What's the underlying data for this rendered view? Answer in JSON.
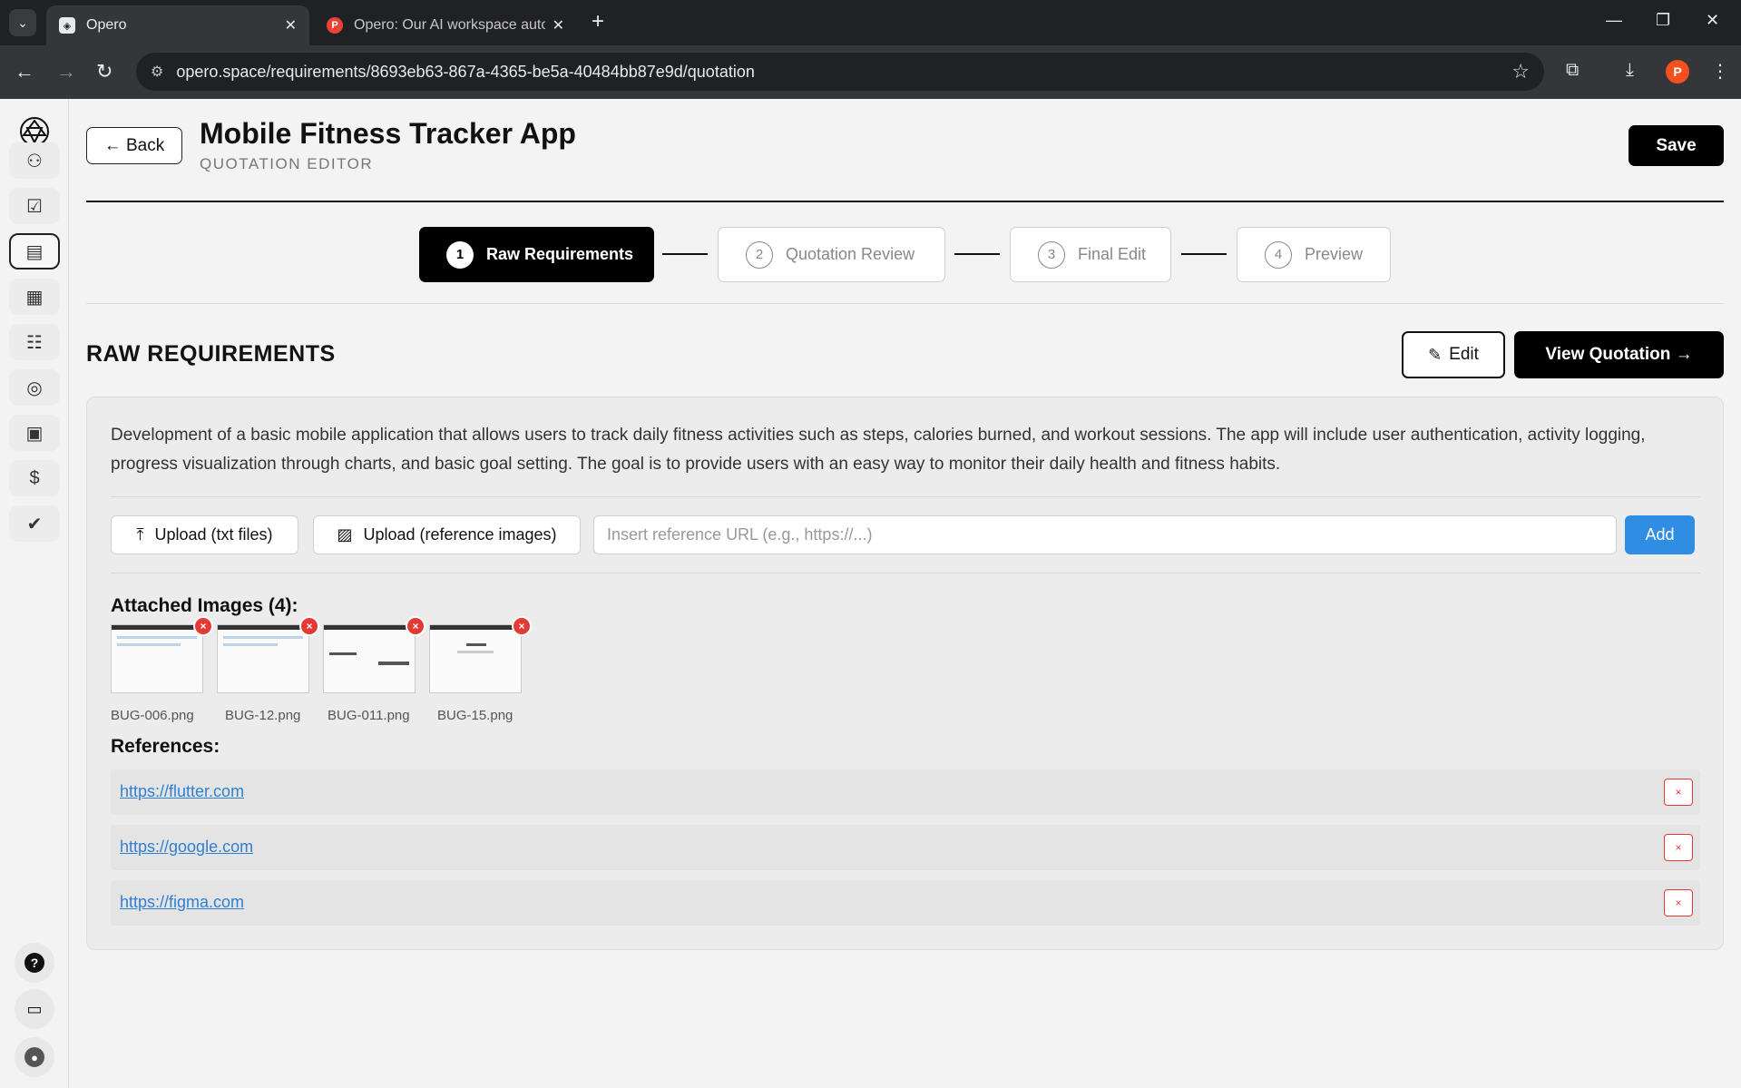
{
  "browser": {
    "tabs": [
      {
        "title": "Opero",
        "active": true
      },
      {
        "title": "Opero: Our AI workspace autom",
        "active": false
      }
    ],
    "url": "opero.space/requirements/8693eb63-867a-4365-be5a-40484bb87e9d/quotation",
    "profile_initial": "P"
  },
  "header": {
    "back_label": "← Back",
    "title": "Mobile Fitness Tracker App",
    "subtitle": "QUOTATION EDITOR",
    "save_label": "Save"
  },
  "steps": [
    {
      "num": "1",
      "label": "Raw Requirements",
      "active": true
    },
    {
      "num": "2",
      "label": "Quotation Review",
      "active": false
    },
    {
      "num": "3",
      "label": "Final Edit",
      "active": false
    },
    {
      "num": "4",
      "label": "Preview",
      "active": false
    }
  ],
  "section": {
    "title": "RAW REQUIREMENTS",
    "edit_label": "Edit",
    "view_label": "View Quotation →"
  },
  "requirements": {
    "description": "Development of a basic mobile application that allows users to track daily fitness activities such as steps, calories burned, and workout sessions. The app will include user authentication, activity logging, progress visualization through charts, and basic goal setting. The goal is to provide users with an easy way to monitor their daily health and fitness habits.",
    "upload_txt_label": "Upload (txt files)",
    "upload_images_label": "Upload (reference images)",
    "url_placeholder": "Insert reference URL (e.g., https://...)",
    "add_label": "Add",
    "attached_title": "Attached Images (4):",
    "images": [
      "BUG-006.png",
      "BUG-12.png",
      "BUG-011.png",
      "BUG-15.png"
    ],
    "references_title": "References:",
    "references": [
      "https://flutter.com",
      "https://google.com",
      "https://figma.com"
    ],
    "remove_symbol": "×"
  },
  "colors": {
    "accent_blue": "#2f8de4",
    "remove_red": "#e53935",
    "primary_black": "#000000"
  }
}
